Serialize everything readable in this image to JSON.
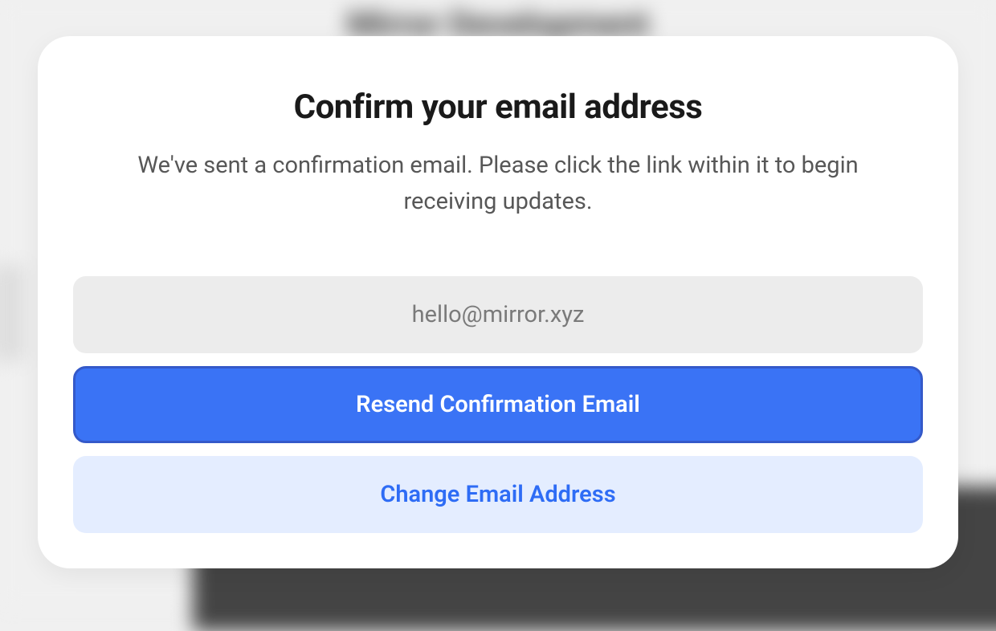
{
  "backdrop": {
    "title": "Mirror Development"
  },
  "modal": {
    "title": "Confirm your email address",
    "subtitle": "We've sent a confirmation email. Please click the link within it to begin receiving updates.",
    "email_value": "hello@mirror.xyz",
    "resend_button_label": "Resend Confirmation Email",
    "change_button_label": "Change Email Address"
  }
}
